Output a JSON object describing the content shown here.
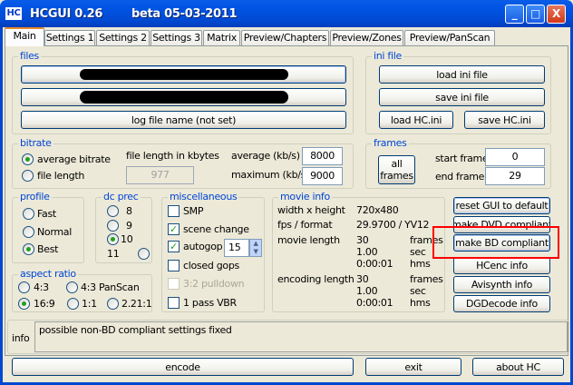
{
  "window": {
    "title": "HCGUI 0.26",
    "subtitle": "beta 05-03-2011",
    "icon_text": "HC",
    "minimize": "_",
    "maximize": "□",
    "close": "X"
  },
  "tabs": [
    "Main",
    "Settings 1",
    "Settings 2",
    "Settings 3",
    "Matrix",
    "Preview/Chapters",
    "Preview/Zones",
    "Preview/PanScan"
  ],
  "files": {
    "title": "files",
    "log_button": "log file name (not set)"
  },
  "ini": {
    "title": "ini file",
    "load": "load ini file",
    "save": "save ini file",
    "load_hc": "load HC.ini",
    "save_hc": "save HC.ini"
  },
  "bitrate": {
    "title": "bitrate",
    "avg_radio": "average bitrate",
    "file_radio": "file length",
    "selected": "average bitrate",
    "file_len_label": "file length in kbytes",
    "file_len_value": "977",
    "avg_label": "average (kb/s)",
    "avg_value": "8000",
    "max_label": "maximum (kb/s)",
    "max_value": "9000"
  },
  "frames": {
    "title": "frames",
    "all_line1": "all",
    "all_line2": "frames",
    "start_label": "start frame",
    "start_value": "0",
    "end_label": "end frame",
    "end_value": "29"
  },
  "profile": {
    "title": "profile",
    "options": [
      "Fast",
      "Normal",
      "Best"
    ],
    "selected": "Best"
  },
  "dcprec": {
    "title": "dc prec",
    "options": [
      "8",
      "9",
      "10",
      "11"
    ],
    "selected": "10"
  },
  "aspect": {
    "title": "aspect ratio",
    "options": [
      "4:3",
      "4:3 PanScan",
      "16:9",
      "1:1",
      "2.21:1"
    ],
    "selected": "16:9"
  },
  "misc": {
    "title": "miscellaneous",
    "smp": "SMP",
    "scene": "scene change",
    "autogop": "autogop",
    "autogop_value": "15",
    "closed": "closed gops",
    "pulldown": "3:2 pulldown",
    "vbr": "1 pass VBR",
    "checked": [
      "scene change",
      "autogop"
    ]
  },
  "movie": {
    "title": "movie info",
    "wh_label": "width x height",
    "wh": "720x480",
    "fps_label": "fps / format",
    "fps": "29.9700 / YV12",
    "ml_label": "movie length",
    "ml": [
      "30",
      "1.00",
      "0:00:01"
    ],
    "el_label": "encoding length",
    "el": [
      "30",
      "1.00",
      "0:00:01"
    ],
    "units": [
      "frames",
      "sec",
      "hms"
    ]
  },
  "actions": {
    "reset": "reset GUI to default",
    "dvd": "make DVD compliant",
    "bd": "make BD compliant",
    "hcenc": "HCenc info",
    "avisynth": "Avisynth info",
    "dgdecode": "DGDecode info",
    "highlight_color": "#FF0000"
  },
  "info": {
    "label": "info",
    "text": "possible non-BD compliant settings fixed"
  },
  "bottom": {
    "encode": "encode",
    "exit": "exit",
    "about": "about HC"
  }
}
